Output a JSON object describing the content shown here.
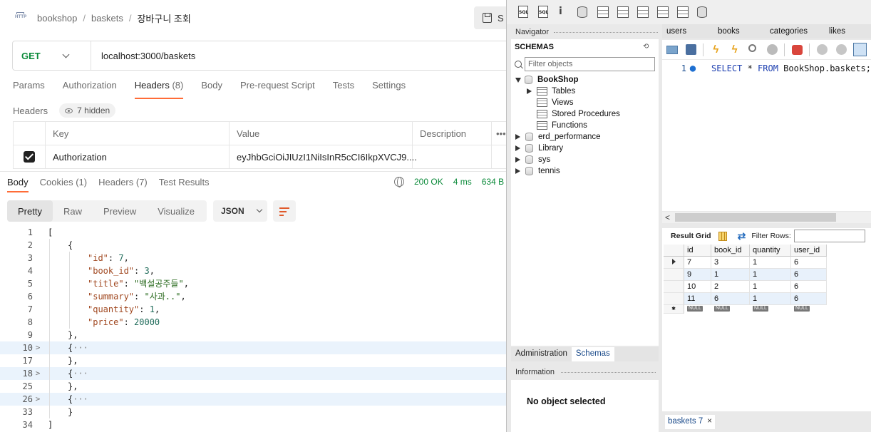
{
  "postman": {
    "breadcrumb": [
      "bookshop",
      "baskets",
      "장바구니 조회"
    ],
    "http_icon_label": "HTTP",
    "save_label": "S",
    "method": "GET",
    "url": "localhost:3000/baskets",
    "request_tabs": [
      {
        "label": "Params",
        "count": ""
      },
      {
        "label": "Authorization",
        "count": ""
      },
      {
        "label": "Headers",
        "count": "(8)"
      },
      {
        "label": "Body",
        "count": ""
      },
      {
        "label": "Pre-request Script",
        "count": ""
      },
      {
        "label": "Tests",
        "count": ""
      },
      {
        "label": "Settings",
        "count": ""
      }
    ],
    "headers_label": "Headers",
    "hidden_label": "7 hidden",
    "header_table": {
      "columns": [
        "Key",
        "Value",
        "Description",
        "•••"
      ],
      "row": {
        "checked": true,
        "key": "Authorization",
        "value": "eyJhbGciOiJIUzI1NiIsInR5cCI6IkpXVCJ9...."
      }
    },
    "response_tabs": [
      "Body",
      "Cookies (1)",
      "Headers (7)",
      "Test Results"
    ],
    "status": "200 OK",
    "time": "4 ms",
    "size": "634 B",
    "view_modes": [
      "Pretty",
      "Raw",
      "Preview",
      "Visualize"
    ],
    "format": "JSON",
    "code_lines": [
      {
        "n": "1",
        "fold": "",
        "indent": 0,
        "text": "[",
        "hl": false
      },
      {
        "n": "2",
        "fold": "",
        "indent": 1,
        "text": "{",
        "hl": false
      },
      {
        "n": "3",
        "fold": "",
        "indent": 2,
        "key": "\"id\"",
        "val": "7",
        "vt": "n",
        "hl": false
      },
      {
        "n": "4",
        "fold": "",
        "indent": 2,
        "key": "\"book_id\"",
        "val": "3",
        "vt": "n",
        "hl": false
      },
      {
        "n": "5",
        "fold": "",
        "indent": 2,
        "key": "\"title\"",
        "val": "\"백설공주들\"",
        "vt": "s",
        "hl": false
      },
      {
        "n": "6",
        "fold": "",
        "indent": 2,
        "key": "\"summary\"",
        "val": "\"사과..\"",
        "vt": "s",
        "hl": false
      },
      {
        "n": "7",
        "fold": "",
        "indent": 2,
        "key": "\"quantity\"",
        "val": "1",
        "vt": "n",
        "hl": false
      },
      {
        "n": "8",
        "fold": "",
        "indent": 2,
        "key": "\"price\"",
        "val": "20000",
        "vt": "n",
        "last": true,
        "hl": false
      },
      {
        "n": "9",
        "fold": "",
        "indent": 1,
        "text": "},",
        "hl": false
      },
      {
        "n": "10",
        "fold": ">",
        "indent": 1,
        "text": "{",
        "dots": "···",
        "hl": true
      },
      {
        "n": "17",
        "fold": "",
        "indent": 1,
        "text": "},",
        "hl": false
      },
      {
        "n": "18",
        "fold": ">",
        "indent": 1,
        "text": "{",
        "dots": "···",
        "hl": true
      },
      {
        "n": "25",
        "fold": "",
        "indent": 1,
        "text": "},",
        "hl": false
      },
      {
        "n": "26",
        "fold": ">",
        "indent": 1,
        "text": "{",
        "dots": "···",
        "hl": true
      },
      {
        "n": "33",
        "fold": "",
        "indent": 1,
        "text": "}",
        "hl": false
      },
      {
        "n": "34",
        "fold": "",
        "indent": 0,
        "text": "]",
        "hl": false
      }
    ]
  },
  "workbench": {
    "toolbar_icons": [
      "new-sql-tab-icon",
      "open-sql-script-icon",
      "schema-inspector-icon",
      "create-schema-icon",
      "create-table-icon",
      "create-view-icon",
      "create-procedure-icon",
      "create-function-icon",
      "search-table-data-icon",
      "reconnect-icon"
    ],
    "navigator_label": "Navigator",
    "schemas_title": "SCHEMAS",
    "filter_placeholder": "Filter objects",
    "tree": [
      {
        "label": "BookShop",
        "level": 0,
        "expanded": true,
        "bold": true,
        "type": "db"
      },
      {
        "label": "Tables",
        "level": 1,
        "expanded": false,
        "type": "folder",
        "arrow": true
      },
      {
        "label": "Views",
        "level": 1,
        "type": "folder",
        "arrow": false
      },
      {
        "label": "Stored Procedures",
        "level": 1,
        "type": "folder",
        "arrow": false
      },
      {
        "label": "Functions",
        "level": 1,
        "type": "folder",
        "arrow": false
      },
      {
        "label": "erd_performance",
        "level": 0,
        "expanded": false,
        "type": "db"
      },
      {
        "label": "Library",
        "level": 0,
        "expanded": false,
        "type": "db"
      },
      {
        "label": "sys",
        "level": 0,
        "expanded": false,
        "type": "db"
      },
      {
        "label": "tennis",
        "level": 0,
        "expanded": false,
        "type": "db"
      }
    ],
    "bottom_tabs": [
      "Administration",
      "Schemas"
    ],
    "information_label": "Information",
    "no_object": "No object selected",
    "editor_tabs": [
      "users",
      "books",
      "categories",
      "likes"
    ],
    "sql": {
      "line": "1",
      "keyword1": "SELECT",
      "middle": " * ",
      "keyword2": "FROM",
      "rest": " BookShop.baskets;"
    },
    "result_grid_label": "Result Grid",
    "filter_rows_label": "Filter Rows:",
    "grid": {
      "columns": [
        "id",
        "book_id",
        "quantity",
        "user_id"
      ],
      "rows": [
        [
          "7",
          "3",
          "1",
          "6"
        ],
        [
          "9",
          "1",
          "1",
          "6"
        ],
        [
          "10",
          "2",
          "1",
          "6"
        ],
        [
          "11",
          "6",
          "1",
          "6"
        ]
      ],
      "null_label": "NULL"
    },
    "result_tab": "baskets 7",
    "result_tab_close": "×"
  }
}
